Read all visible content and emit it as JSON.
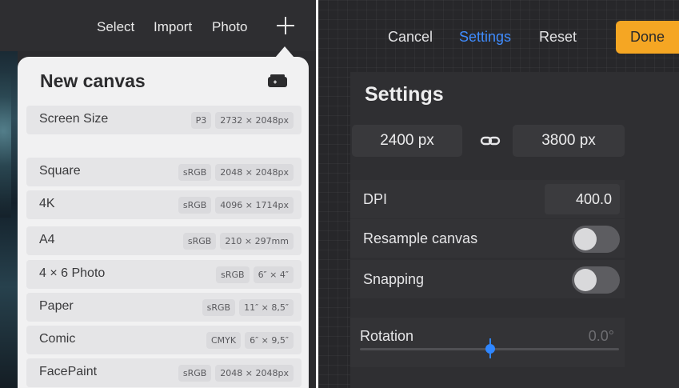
{
  "left": {
    "topbar": {
      "select": "Select",
      "import": "Import",
      "photo": "Photo"
    },
    "popover": {
      "title": "New canvas",
      "screen_size": {
        "name": "Screen Size",
        "color": "P3",
        "size": "2732 × 2048px"
      },
      "presets": [
        {
          "name": "Square",
          "color": "sRGB",
          "size": "2048 × 2048px"
        },
        {
          "name": "4K",
          "color": "sRGB",
          "size": "4096 × 1714px"
        },
        {
          "name": "A4",
          "color": "sRGB",
          "size": "210 × 297mm"
        },
        {
          "name": "4 × 6 Photo",
          "color": "sRGB",
          "size": "6″ × 4″"
        },
        {
          "name": "Paper",
          "color": "sRGB",
          "size": "11″ × 8,5″"
        },
        {
          "name": "Comic",
          "color": "CMYK",
          "size": "6″ × 9,5″"
        },
        {
          "name": "FacePaint",
          "color": "sRGB",
          "size": "2048 × 2048px"
        }
      ]
    }
  },
  "right": {
    "tabs": {
      "cancel": "Cancel",
      "settings": "Settings",
      "reset": "Reset",
      "done": "Done"
    },
    "title": "Settings",
    "width": "2400 px",
    "height": "3800 px",
    "dpi": {
      "label": "DPI",
      "value": "400.0"
    },
    "resample": {
      "label": "Resample canvas",
      "on": false
    },
    "snapping": {
      "label": "Snapping",
      "on": false
    },
    "rotation": {
      "label": "Rotation",
      "value": "0.0°"
    }
  },
  "colors": {
    "accent": "#3f8cff",
    "done": "#f5a623"
  },
  "icons": [
    "plus-icon",
    "new-canvas-icon",
    "link-icon"
  ]
}
